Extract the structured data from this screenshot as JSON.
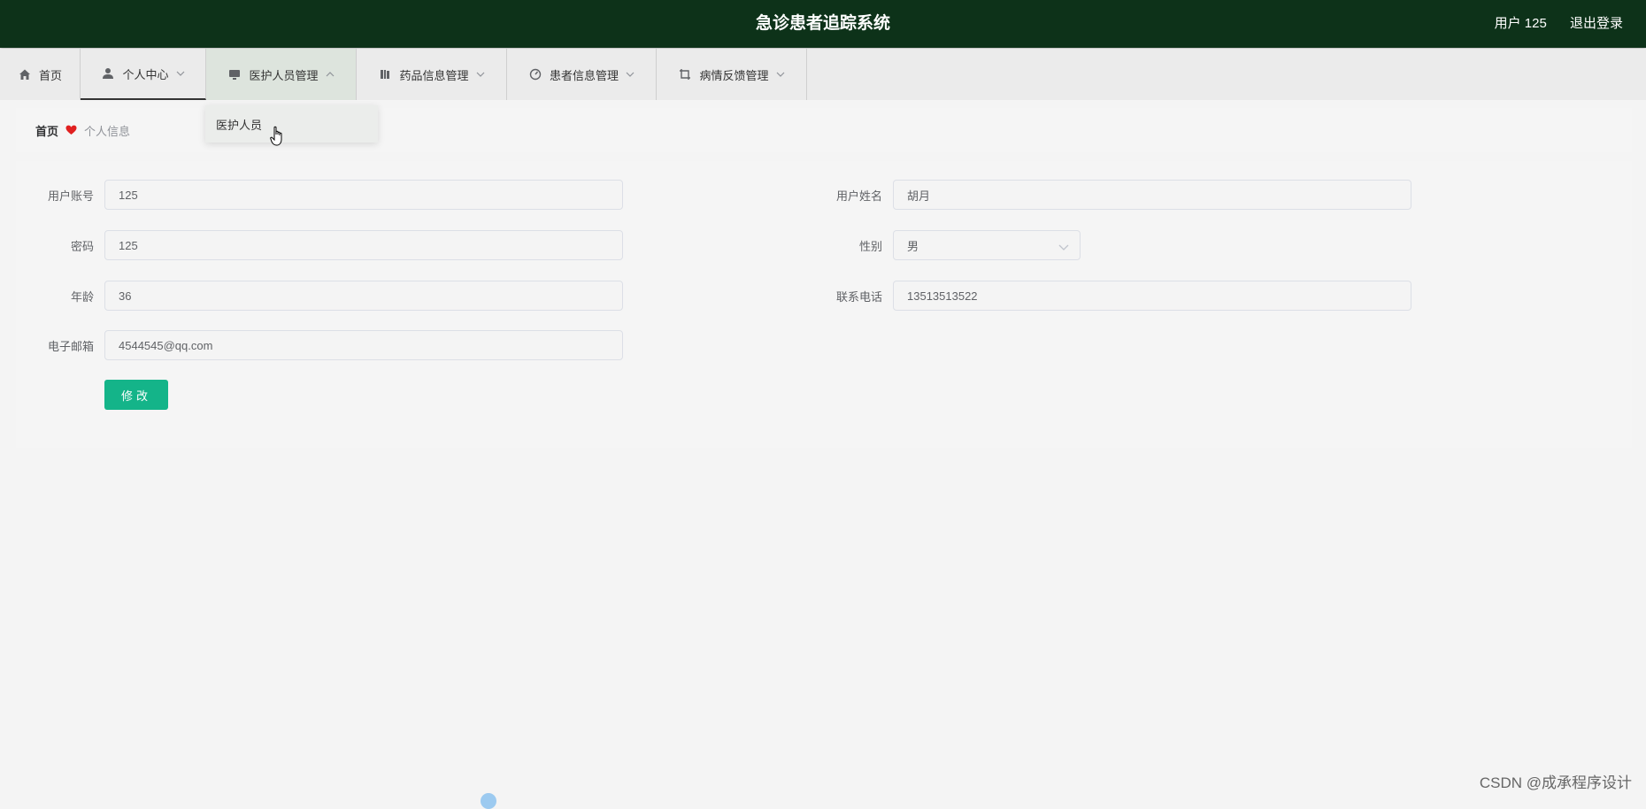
{
  "header": {
    "title": "急诊患者追踪系统",
    "user_label": "用户 125",
    "logout_label": "退出登录"
  },
  "nav": {
    "items": [
      {
        "label": "首页",
        "icon": "home-icon"
      },
      {
        "label": "个人中心",
        "icon": "user-icon"
      },
      {
        "label": "医护人员管理",
        "icon": "monitor-icon"
      },
      {
        "label": "药品信息管理",
        "icon": "book-icon"
      },
      {
        "label": "患者信息管理",
        "icon": "gauge-icon"
      },
      {
        "label": "病情反馈管理",
        "icon": "crop-icon"
      }
    ],
    "dropdown_item": "医护人员"
  },
  "breadcrumb": {
    "home": "首页",
    "current": "个人信息"
  },
  "form": {
    "account": {
      "label": "用户账号",
      "value": "125"
    },
    "name": {
      "label": "用户姓名",
      "value": "胡月"
    },
    "password": {
      "label": "密码",
      "value": "125"
    },
    "gender": {
      "label": "性别",
      "value": "男"
    },
    "age": {
      "label": "年龄",
      "value": "36"
    },
    "phone": {
      "label": "联系电话",
      "value": "13513513522"
    },
    "email": {
      "label": "电子邮箱",
      "value": "4544545@qq.com"
    },
    "submit_label": "修改"
  },
  "watermark": "CSDN @成承程序设计",
  "colors": {
    "header_bg": "#0d3219",
    "primary_button": "#14b489",
    "heart": "#e02020"
  }
}
